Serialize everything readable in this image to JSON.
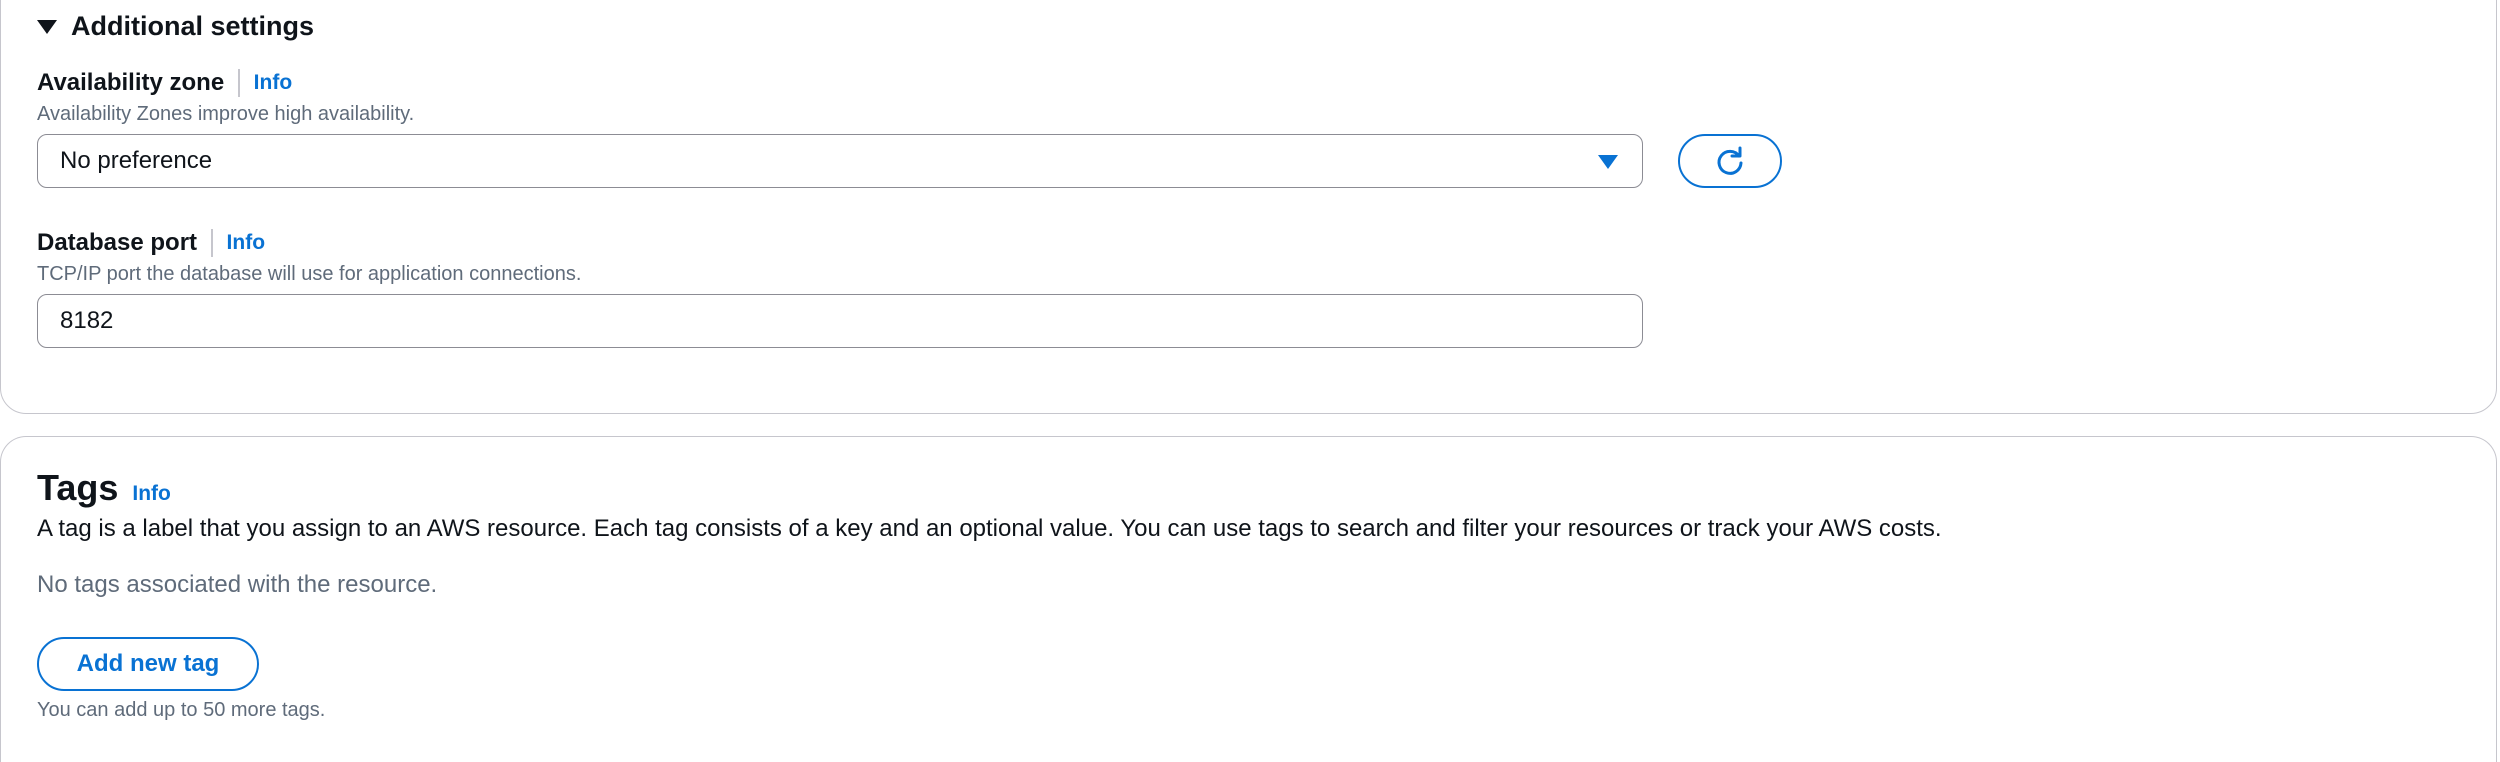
{
  "additional_settings": {
    "title": "Additional settings",
    "availability_zone": {
      "label": "Availability zone",
      "info": "Info",
      "description": "Availability Zones improve high availability.",
      "selected": "No preference"
    },
    "database_port": {
      "label": "Database port",
      "info": "Info",
      "description": "TCP/IP port the database will use for application connections.",
      "value": "8182"
    }
  },
  "tags": {
    "title": "Tags",
    "info": "Info",
    "description": "A tag is a label that you assign to an AWS resource. Each tag consists of a key and an optional value. You can use tags to search and filter your resources or track your AWS costs.",
    "empty_text": "No tags associated with the resource.",
    "add_button": "Add new tag",
    "limit_text": "You can add up to 50 more tags."
  },
  "colors": {
    "link": "#0972d3",
    "border": "#c6c6cd",
    "text": "#0f141a",
    "secondary_text": "#5f6b7a"
  },
  "icons": {
    "expander": "caret-down-icon",
    "select": "caret-down-icon",
    "refresh": "refresh-icon"
  }
}
